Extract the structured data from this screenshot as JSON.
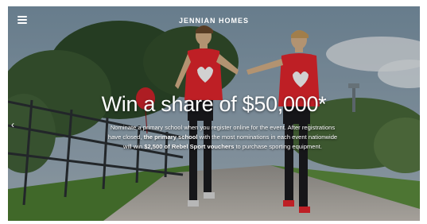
{
  "header": {
    "brand": "JENNIAN HOMES"
  },
  "hero": {
    "headline": "Win a share of $50,000*",
    "body": {
      "p1": "Nominate a primary school when you register online for the event. After registrations have closed, ",
      "b1": "the primary school",
      "p2": " with the most nominations in each event nationwide will win ",
      "b2": "$2,500 of Rebel Sport vouchers",
      "p3": " to purchase sporting equipment."
    }
  },
  "icons": {
    "menu": "hamburger-menu-icon",
    "prev": "chevron-left-icon"
  },
  "colors": {
    "sky": "#6f8a9e",
    "shirt": "#e8272e",
    "grass": "#5b8a3c",
    "path": "#b8b3ac",
    "text": "#ffffff"
  }
}
